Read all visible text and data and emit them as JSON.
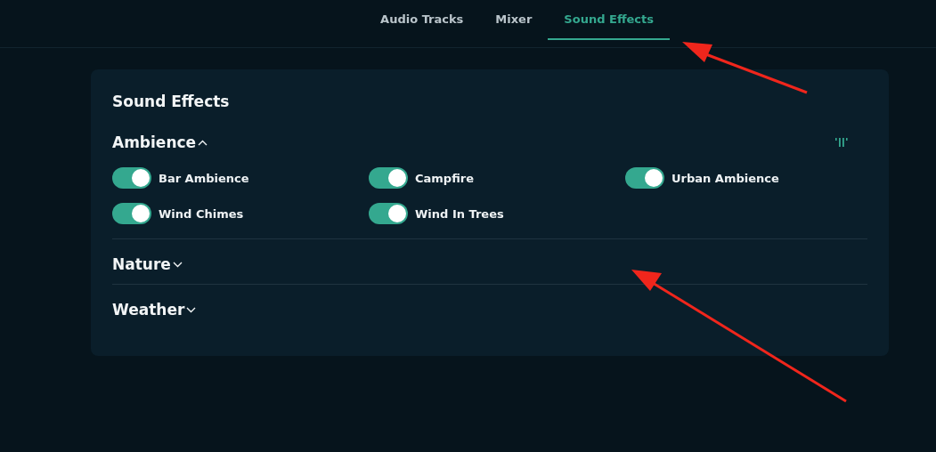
{
  "tabs": [
    {
      "label": "Audio Tracks",
      "selected": false
    },
    {
      "label": "Mixer",
      "selected": false
    },
    {
      "label": "Sound Effects",
      "selected": true
    }
  ],
  "panel": {
    "title": "Sound Effects",
    "categories": [
      {
        "name": "Ambience",
        "expanded": true,
        "items": [
          {
            "label": "Bar Ambience",
            "on": true
          },
          {
            "label": "Campfire",
            "on": true
          },
          {
            "label": "Urban Ambience",
            "on": true
          },
          {
            "label": "Wind Chimes",
            "on": true
          },
          {
            "label": "Wind In Trees",
            "on": true
          }
        ]
      },
      {
        "name": "Nature",
        "expanded": false
      },
      {
        "name": "Weather",
        "expanded": false
      }
    ]
  }
}
